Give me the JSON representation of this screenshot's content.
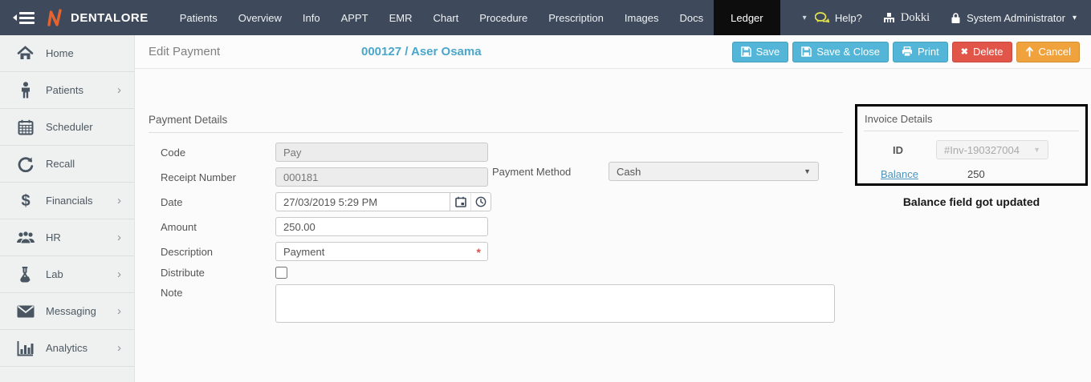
{
  "topbar": {
    "brand": "DENTALORE",
    "tabs": [
      "Patients",
      "Overview",
      "Info",
      "APPT",
      "EMR",
      "Chart",
      "Procedure",
      "Prescription",
      "Images",
      "Docs",
      "Ledger"
    ],
    "active_tab": "Ledger",
    "help_label": "Help?",
    "clinic_name": "Dokki",
    "user_name": "System Administrator"
  },
  "sidebar": {
    "items": [
      {
        "label": "Home",
        "icon": "home-icon",
        "has_submenu": false
      },
      {
        "label": "Patients",
        "icon": "patient-icon",
        "has_submenu": true
      },
      {
        "label": "Scheduler",
        "icon": "calendar-icon",
        "has_submenu": false
      },
      {
        "label": "Recall",
        "icon": "recall-icon",
        "has_submenu": false
      },
      {
        "label": "Financials",
        "icon": "dollar-icon",
        "has_submenu": true
      },
      {
        "label": "HR",
        "icon": "people-icon",
        "has_submenu": true
      },
      {
        "label": "Lab",
        "icon": "flask-icon",
        "has_submenu": true
      },
      {
        "label": "Messaging",
        "icon": "envelope-icon",
        "has_submenu": true
      },
      {
        "label": "Analytics",
        "icon": "bar-chart-icon",
        "has_submenu": true
      }
    ]
  },
  "header": {
    "title": "Edit Payment",
    "patient_link": "000127 / Aser Osama",
    "buttons": {
      "save": "Save",
      "save_close": "Save & Close",
      "print": "Print",
      "delete": "Delete",
      "cancel": "Cancel"
    }
  },
  "form": {
    "section_title": "Payment Details",
    "code": {
      "label": "Code",
      "value": "Pay"
    },
    "receipt": {
      "label": "Receipt Number",
      "value": "000181"
    },
    "date": {
      "label": "Date",
      "value": "27/03/2019 5:29 PM"
    },
    "amount": {
      "label": "Amount",
      "value": "250.00"
    },
    "description": {
      "label": "Description",
      "value": "Payment",
      "required_marker": "*"
    },
    "distribute": {
      "label": "Distribute",
      "checked": false
    },
    "note": {
      "label": "Note",
      "value": ""
    },
    "payment_method": {
      "label": "Payment Method",
      "value": "Cash"
    }
  },
  "invoice_details": {
    "title": "Invoice Details",
    "id_label": "ID",
    "id_value": "#Inv-190327004",
    "balance_label": "Balance",
    "balance_value": "250",
    "annotation": "Balance field got updated"
  },
  "glyphs": {
    "dropdown_caret": "▼",
    "nav_caret": "▾",
    "user_caret": "⌄",
    "submenu_chevron": "›",
    "delete_x": "✖"
  },
  "colors": {
    "topbar_bg": "#3e4a5b",
    "active_tab_bg": "#0d0d0d",
    "accent_cyan": "#53b5d7",
    "danger_red": "#e25549",
    "warning_orange": "#f0a23c",
    "link_blue": "#4ba6ca",
    "logo_orange": "#e8622d",
    "help_icon_yellow": "#e5e34a"
  }
}
